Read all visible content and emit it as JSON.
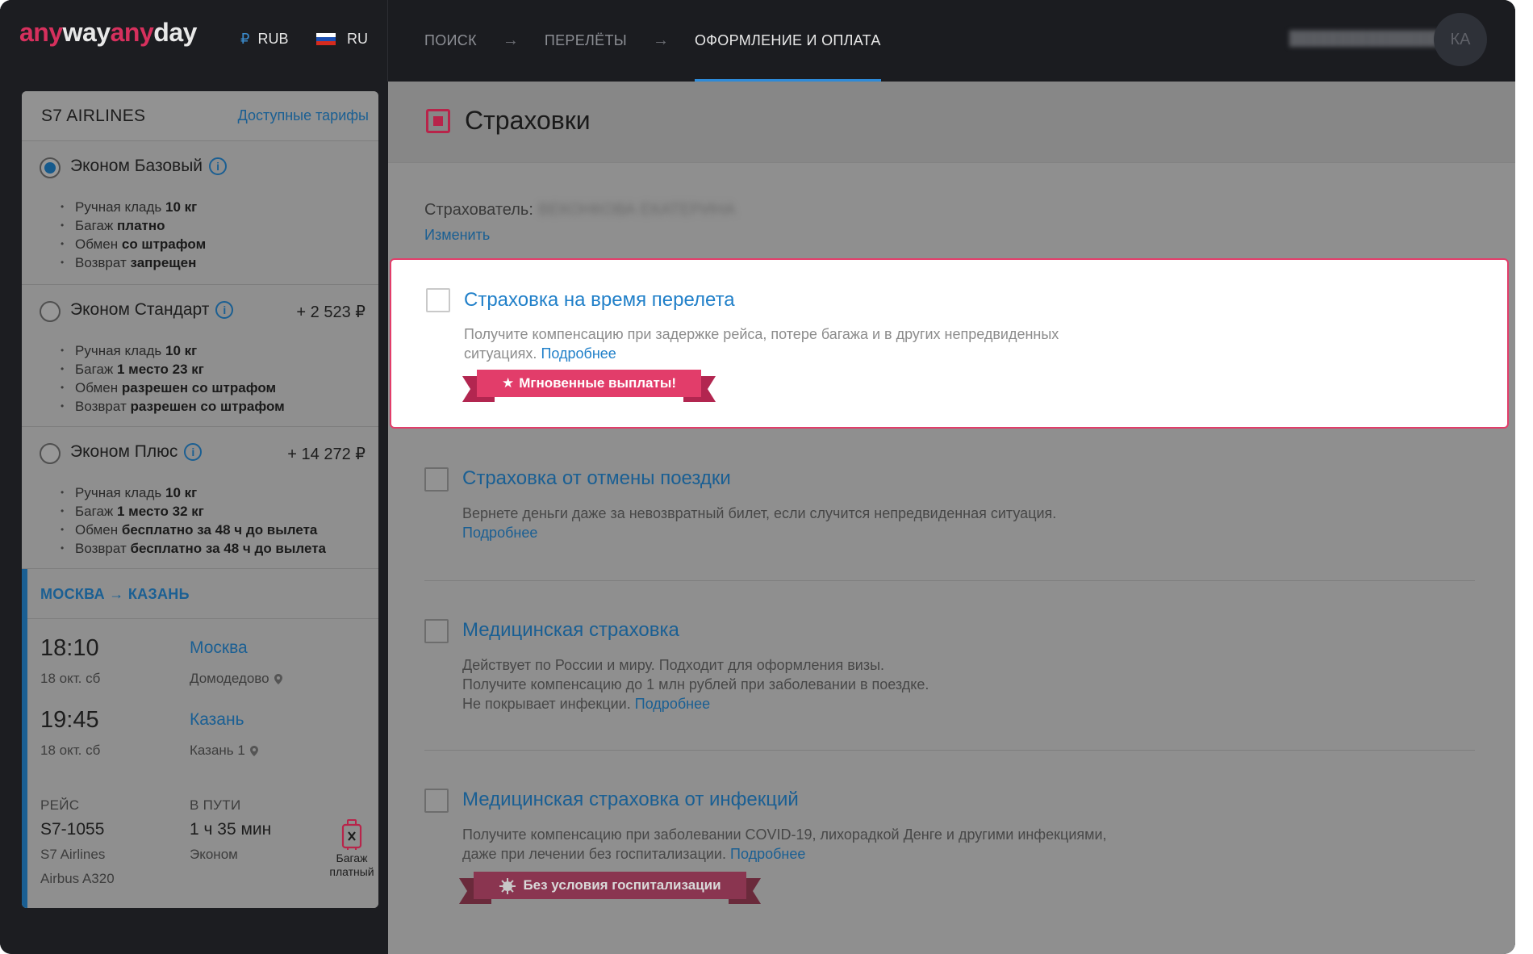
{
  "brand": {
    "logo_part1": "any",
    "logo_part2": "way",
    "logo_part3": "any",
    "logo_part4": "day"
  },
  "header": {
    "currency_symbol": "₽",
    "currency": "RUB",
    "language": "RU",
    "steps": [
      "ПОИСК",
      "ПЕРЕЛЁТЫ",
      "ОФОРМЛЕНИЕ И ОПЛАТА"
    ],
    "arrow": "→",
    "user_initials": "КА"
  },
  "fares": {
    "airline": "S7 AIRLINES",
    "available_tariffs": "Доступные тарифы",
    "items": [
      {
        "name": "Эконом Базовый",
        "price": "",
        "selected": true,
        "features": [
          {
            "label": "Ручная кладь",
            "value": "10 кг"
          },
          {
            "label": "Багаж",
            "value": "платно"
          },
          {
            "label": "Обмен",
            "value": "со штрафом"
          },
          {
            "label": "Возврат",
            "value": "запрещен"
          }
        ]
      },
      {
        "name": "Эконом Стандарт",
        "price": "+ 2 523 ₽",
        "selected": false,
        "features": [
          {
            "label": "Ручная кладь",
            "value": "10 кг"
          },
          {
            "label": "Багаж",
            "value": "1 место 23 кг"
          },
          {
            "label": "Обмен",
            "value": "разрешен со штрафом"
          },
          {
            "label": "Возврат",
            "value": "разрешен со штрафом"
          }
        ]
      },
      {
        "name": "Эконом Плюс",
        "price": "+ 14 272 ₽",
        "selected": false,
        "features": [
          {
            "label": "Ручная кладь",
            "value": "10 кг"
          },
          {
            "label": "Багаж",
            "value": "1 место 32 кг"
          },
          {
            "label": "Обмен",
            "value": "бесплатно за 48 ч до вылета"
          },
          {
            "label": "Возврат",
            "value": "бесплатно за 48 ч до вылета"
          }
        ]
      }
    ]
  },
  "route": {
    "from": "МОСКВА",
    "arrow": "→",
    "to": "КАЗАНЬ",
    "departure": {
      "time": "18:10",
      "date": "18 окт. сб",
      "city": "Москва",
      "airport": "Домодедово"
    },
    "arrival": {
      "time": "19:45",
      "date": "18 окт. сб",
      "city": "Казань",
      "airport": "Казань 1"
    },
    "flight_label": "РЕЙС",
    "flight_number": "S7-1055",
    "carrier": "S7 Airlines",
    "aircraft": "Airbus A320",
    "duration_label": "В ПУТИ",
    "duration": "1 ч 35 мин",
    "cabin": "Эконом",
    "baggage_line1": "Багаж",
    "baggage_line2": "платный"
  },
  "insurance": {
    "title": "Страховки",
    "insurer_label": "Страхователь:",
    "insurer_name": "ВЕКОНКОВА ЕКАТЕРИНА",
    "change": "Изменить",
    "more": "Подробнее",
    "items": [
      {
        "title": "Страховка на время перелета",
        "desc": "Получите компенсацию при задержке рейса, потере багажа и в других непредвиденных ситуациях.",
        "badge": "Мгновенные выплаты!"
      },
      {
        "title": "Страховка от отмены поездки",
        "desc": "Вернете деньги даже за невозвратный билет, если случится непредвиденная ситуация."
      },
      {
        "title": "Медицинская страховка",
        "desc_line1": "Действует по России и миру. Подходит для оформления визы.",
        "desc_line2": "Получите компенсацию до 1 млн рублей при заболевании в поездке.",
        "desc_line3": "Не покрывает инфекции."
      },
      {
        "title": "Медицинская страховка от инфекций",
        "desc_line1": "Получите компенсацию при заболевании COVID-19, лихорадкой Денге и другими инфекциями,",
        "desc_line2": "даже при лечении без госпитализации.",
        "badge": "Без условия госпитализации"
      }
    ]
  },
  "colors": {
    "accent_pink": "#e23d6a",
    "link_blue": "#1a5f93",
    "active_blue": "#2d8ad8"
  }
}
